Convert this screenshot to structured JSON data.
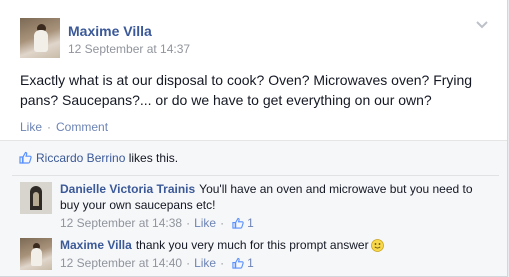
{
  "post": {
    "author": "Maxime Villa",
    "timestamp": "12 September at 14:37",
    "text": "Exactly what is at our disposal to cook? Oven? Microwaves oven? Frying pans? Saucepans?... or do we have to get everything on our own?",
    "actions": {
      "like": "Like",
      "separator": "·",
      "comment": "Comment"
    }
  },
  "likes": {
    "liker": "Riccardo Berrino",
    "suffix": "likes this."
  },
  "comments": [
    {
      "author": "Danielle Victoria Trainis",
      "text": "You'll have an oven and microwave but you need to buy your own saucepans etc!",
      "timestamp": "12 September at 14:38",
      "separator": "·",
      "like_label": "Like",
      "like_count": "1"
    },
    {
      "author": "Maxime Villa",
      "text": "thank you very much for this prompt answer",
      "timestamp": "12 September at 14:40",
      "separator": "·",
      "like_label": "Like",
      "like_count": "1"
    }
  ],
  "colors": {
    "link": "#3b5998",
    "muted_link": "#6d84b4",
    "meta": "#90949c",
    "background": "#f6f7f9"
  },
  "icons": {
    "options": "chevron-down-icon",
    "like": "thumbs-up-icon",
    "emoticon": "smiley-icon"
  }
}
